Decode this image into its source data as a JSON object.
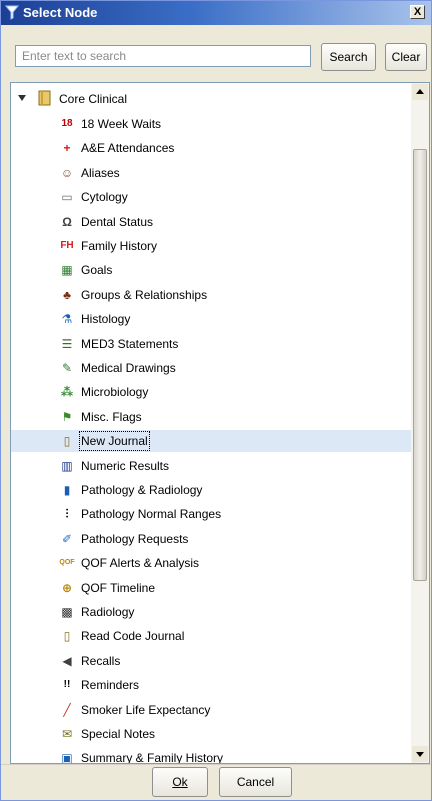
{
  "window": {
    "title": "Select Node",
    "close_label": "X"
  },
  "search": {
    "placeholder": "Enter text to search",
    "value": "",
    "search_label": "Search",
    "clear_label": "Clear"
  },
  "tree": {
    "root_label": "Core Clinical",
    "selected_index": 14,
    "items": [
      {
        "label": "18 Week Waits",
        "icon": "18-week-waits-icon",
        "glyph": "18",
        "color": "#c00000"
      },
      {
        "label": "A&E Attendances",
        "icon": "ae-attendances-icon",
        "glyph": "+",
        "color": "#d81b1b"
      },
      {
        "label": "Aliases",
        "icon": "aliases-icon",
        "glyph": "☺",
        "color": "#7a4a2a"
      },
      {
        "label": "Cytology",
        "icon": "cytology-icon",
        "glyph": "▭",
        "color": "#707070"
      },
      {
        "label": "Dental Status",
        "icon": "tooth-icon",
        "glyph": "Ω",
        "color": "#404040"
      },
      {
        "label": "Family History",
        "icon": "family-history-icon",
        "glyph": "FH",
        "color": "#d81b1b"
      },
      {
        "label": "Goals",
        "icon": "goals-icon",
        "glyph": "▦",
        "color": "#2e7d32"
      },
      {
        "label": "Groups & Relationships",
        "icon": "groups-icon",
        "glyph": "♣",
        "color": "#7a2f12"
      },
      {
        "label": "Histology",
        "icon": "microscope-icon",
        "glyph": "⚗",
        "color": "#1a5fb4"
      },
      {
        "label": "MED3 Statements",
        "icon": "med3-icon",
        "glyph": "☰",
        "color": "#3a6f2a"
      },
      {
        "label": "Medical Drawings",
        "icon": "medical-drawings-icon",
        "glyph": "✎",
        "color": "#2e7d32"
      },
      {
        "label": "Microbiology",
        "icon": "microbiology-icon",
        "glyph": "⁂",
        "color": "#2e8b2e"
      },
      {
        "label": "Misc. Flags",
        "icon": "misc-flags-icon",
        "glyph": "⚑",
        "color": "#3a8a2a"
      },
      {
        "label": "New Journal",
        "icon": "journal-icon",
        "glyph": "▯",
        "color": "#8a6d1c"
      },
      {
        "label": "Numeric Results",
        "icon": "numeric-results-icon",
        "glyph": "▥",
        "color": "#1a3a8a"
      },
      {
        "label": "Pathology & Radiology",
        "icon": "pathology-radiology-icon",
        "glyph": "▮",
        "color": "#1a5fb4"
      },
      {
        "label": "Pathology Normal Ranges",
        "icon": "normal-ranges-icon",
        "glyph": "⫶",
        "color": "#000000"
      },
      {
        "label": "Pathology Requests",
        "icon": "syringe-icon",
        "glyph": "✐",
        "color": "#1a6fd4"
      },
      {
        "label": "QOF Alerts & Analysis",
        "icon": "qof-alerts-icon",
        "glyph": "QOF",
        "color": "#b8860b"
      },
      {
        "label": "QOF Timeline",
        "icon": "qof-timeline-icon",
        "glyph": "⊕",
        "color": "#b8860b"
      },
      {
        "label": "Radiology",
        "icon": "radiology-icon",
        "glyph": "▩",
        "color": "#303030"
      },
      {
        "label": "Read Code Journal",
        "icon": "read-code-journal-icon",
        "glyph": "▯",
        "color": "#8a6d1c"
      },
      {
        "label": "Recalls",
        "icon": "recalls-icon",
        "glyph": "◀",
        "color": "#404040"
      },
      {
        "label": "Reminders",
        "icon": "reminders-icon",
        "glyph": "!!",
        "color": "#000000"
      },
      {
        "label": "Smoker Life Expectancy",
        "icon": "smoker-icon",
        "glyph": "╱",
        "color": "#c0392b"
      },
      {
        "label": "Special Notes",
        "icon": "special-notes-icon",
        "glyph": "✉",
        "color": "#6b6b1a"
      },
      {
        "label": "Summary & Family History",
        "icon": "summary-icon",
        "glyph": "▣",
        "color": "#1a5fb4"
      }
    ]
  },
  "footer": {
    "ok_label": "Ok",
    "cancel_label": "Cancel"
  }
}
